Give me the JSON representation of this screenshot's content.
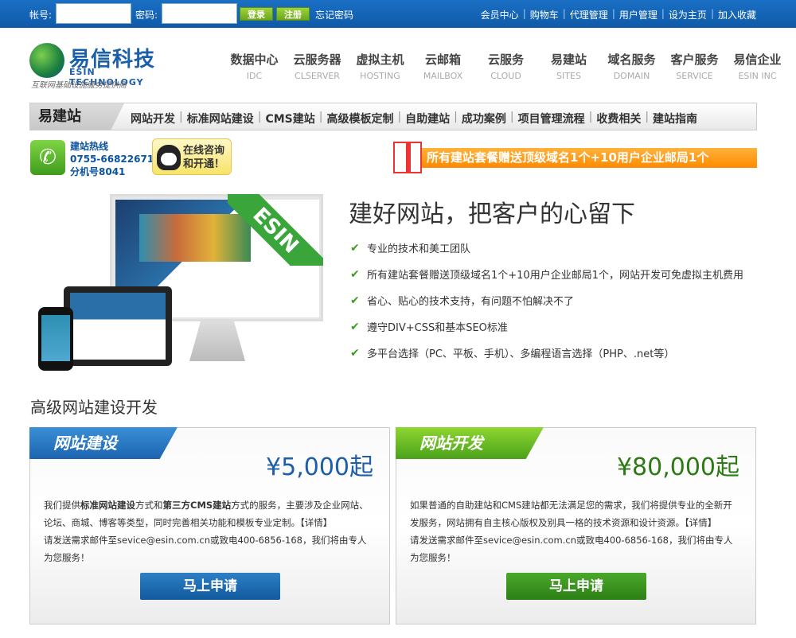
{
  "topbar": {
    "account_label": "帐号:",
    "password_label": "密码:",
    "login_label": "登录",
    "register_label": "注册",
    "forgot_label": "忘记密码",
    "links": [
      "会员中心",
      "购物车",
      "代理管理",
      "用户管理",
      "设为主页",
      "加入收藏"
    ]
  },
  "logo": {
    "name": "易信科技",
    "en": "ESIN TECHNOLOGY",
    "slogan": "互联网基础设施服务提供商"
  },
  "mainnav": [
    {
      "cn": "数据中心",
      "en": "IDC"
    },
    {
      "cn": "云服务器",
      "en": "CLSERVER"
    },
    {
      "cn": "虚拟主机",
      "en": "HOSTING"
    },
    {
      "cn": "云邮箱",
      "en": "MAILBOX"
    },
    {
      "cn": "云服务",
      "en": "CLOUD"
    },
    {
      "cn": "易建站",
      "en": "SITES"
    },
    {
      "cn": "域名服务",
      "en": "DOMAIN"
    },
    {
      "cn": "客户服务",
      "en": "SERVICE"
    },
    {
      "cn": "易信企业",
      "en": "ESIN INC"
    }
  ],
  "subnav": {
    "title": "易建站",
    "links": [
      "网站开发",
      "标准网站建设",
      "CMS建站",
      "高级模板定制",
      "自助建站",
      "成功案例",
      "项目管理流程",
      "收费相关",
      "建站指南"
    ]
  },
  "hotline": {
    "line1": "建站热线",
    "line2": "0755-66822671",
    "line3": "分机号8041"
  },
  "consult": {
    "line1": "在线咨询",
    "line2": "和开通！"
  },
  "promo": "所有建站套餐赠送顶级域名1个+10用户企业邮局1个",
  "hero": {
    "ribbon": "ESIN",
    "title": "建好网站，把客户的心留下",
    "features": [
      "专业的技术和美工团队",
      "所有建站套餐赠送顶级域名1个+10用户企业邮局1个，网站开发可免虚拟主机费用",
      "省心、贴心的技术支持，有问题不怕解决不了",
      "遵守DIV+CSS和基本SEO标准",
      "多平台选择（PC、平板、手机）、多编程语言选择（PHP、.net等）"
    ]
  },
  "section_title": "高级网站建设开发",
  "cards": [
    {
      "tag": "网站建设",
      "price": "¥5,000起",
      "desc_pre": "我们提供",
      "desc_b1": "标准网站建设",
      "desc_mid": "方式和",
      "desc_b2": "第三方CMS建站",
      "desc_post": "方式的服务，主要涉及企业网站、论坛、商城、博客等类型，同时完善相关功能和模板专业定制。【详情】",
      "contact": "请发送需求邮件至sevice@esin.com.cn或致电400-6856-168，我们将由专人为您服务！",
      "apply": "马上申请"
    },
    {
      "tag": "网站开发",
      "price": "¥80,000起",
      "desc": "如果普通的自助建站和CMS建站都无法满足您的需求，我们将提供专业的全新开发服务，网站拥有自主核心版权及别具一格的技术资源和设计资源。【详情】",
      "contact": "请发送需求邮件至sevice@esin.com.cn或致电400-6856-168，我们将由专人为您服务！",
      "apply": "马上申请"
    }
  ]
}
